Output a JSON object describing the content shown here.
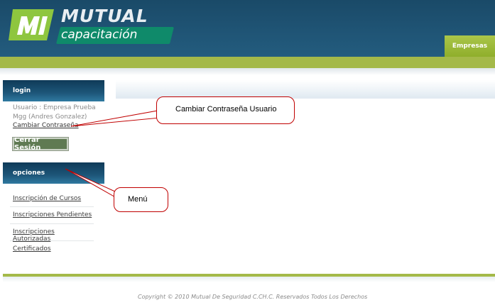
{
  "header": {
    "logo_text": "MUTUAL",
    "logo_subtext": "capacitación",
    "tab_label": "Empresas"
  },
  "login": {
    "title": "login",
    "user_line1": "Usuario : Empresa Prueba",
    "user_line2": "Mgg (Andres Gonzalez)",
    "change_password": "Cambiar Contraseña",
    "logout_button": "Cerrar Sesión"
  },
  "opciones": {
    "title": "opciones",
    "items": [
      {
        "label": "Inscripción de Cursos"
      },
      {
        "label": "Inscripciones Pendientes"
      },
      {
        "label": "Inscripciones Autorizadas"
      },
      {
        "label": "Certificados"
      }
    ]
  },
  "annotations": {
    "change_password_callout": "Cambiar Contraseña Usuario",
    "menu_callout": "Menú"
  },
  "footer": {
    "copyright": "Copyright © 2010 Mutual De Seguridad C.CH.C. Reservados Todos Los Derechos"
  },
  "colors": {
    "header_blue": "#1f5475",
    "accent_green": "#a4b949",
    "callout_border": "#c00000"
  }
}
